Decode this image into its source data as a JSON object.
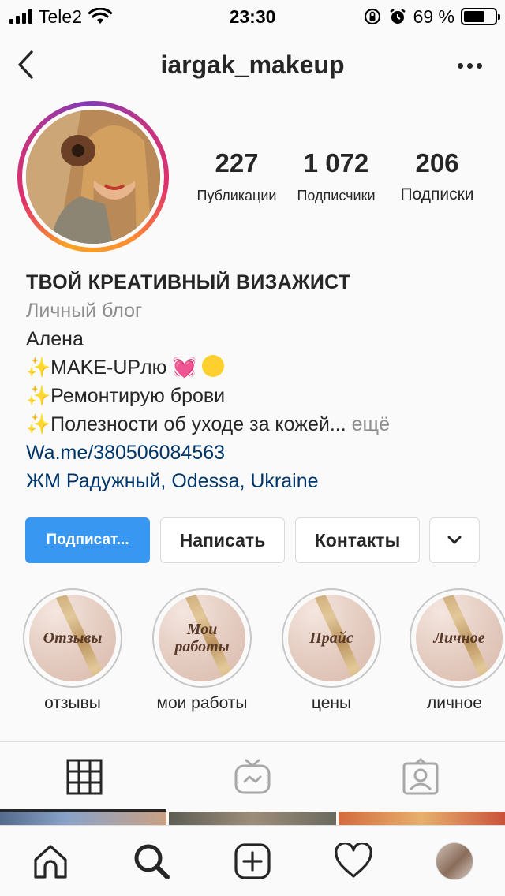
{
  "status_bar": {
    "carrier": "Tele2",
    "time": "23:30",
    "battery_text": "69 %",
    "battery_level": 0.69
  },
  "header": {
    "username": "iargak_makeup"
  },
  "stats": [
    {
      "num": "227",
      "label": "Публикации"
    },
    {
      "num": "1 072",
      "label": "Подписчики"
    },
    {
      "num": "206",
      "label": "Подписки"
    }
  ],
  "bio": {
    "name": "ТВОЙ КРЕАТИВНЫЙ ВИЗАЖИСТ",
    "category": "Личный блог",
    "line1": "Алена",
    "sparkle": "✨",
    "line2": "MAKE-UPлю",
    "heart": "💓",
    "line3": "Ремонтирую брови",
    "line4": "Полезности об уходе за кожей...",
    "more": "ещё",
    "link": "Wa.me/380506084563",
    "location": "ЖМ Радужный, Odessa, Ukraine"
  },
  "actions": {
    "follow": "Подписат...",
    "message": "Написать",
    "contacts": "Контакты"
  },
  "highlights": [
    {
      "cover": "Отзывы",
      "label": "отзывы"
    },
    {
      "cover": "Мои работы",
      "label": "мои работы"
    },
    {
      "cover": "Прайс",
      "label": "цены"
    },
    {
      "cover": "Личное",
      "label": "личное"
    }
  ],
  "tabs": [
    "grid-icon",
    "igtv-icon",
    "tagged-icon"
  ],
  "bottom_nav": [
    "home-icon",
    "search-icon",
    "add-post-icon",
    "activity-heart-icon",
    "profile-avatar"
  ],
  "colors": {
    "accent": "#3897f0",
    "link": "#003569",
    "muted": "#8e8e8e",
    "text": "#262626"
  }
}
